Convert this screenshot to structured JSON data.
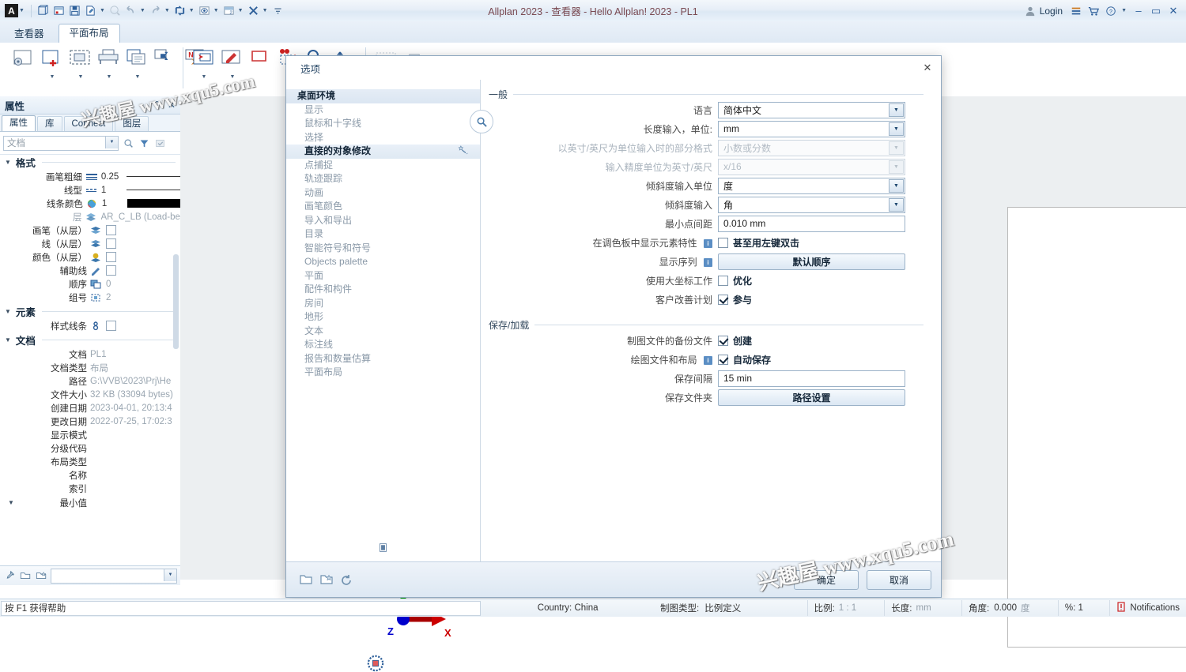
{
  "window": {
    "title": "Allplan 2023 - 查看器 - Hello Allplan! 2023 - PL1",
    "logo": "A",
    "login_label": "Login",
    "toolbar_icons": [
      "app-menu",
      "new-project",
      "project-settings",
      "save",
      "edit-file",
      "zoom",
      "undo",
      "redo",
      "refresh",
      "view",
      "layer",
      "tools",
      "overflow"
    ],
    "controls": {
      "minimize": "–",
      "maximize": "▭",
      "close": "✕"
    }
  },
  "tabs": [
    {
      "label": "查看器",
      "active": false
    },
    {
      "label": "平面布局",
      "active": true
    }
  ],
  "palette": {
    "title": "属性",
    "tabs": [
      {
        "label": "属性",
        "active": true
      },
      {
        "label": "库",
        "active": false
      },
      {
        "label": "Connect",
        "active": false
      },
      {
        "label": "图层",
        "active": false
      }
    ],
    "filter_placeholder": "文档",
    "sections": [
      {
        "name": "格式",
        "rows": [
          {
            "label": "画笔粗细",
            "icon": "pen-width-icon",
            "value": "0.25",
            "kind": "line-solid"
          },
          {
            "label": "线型",
            "icon": "line-type-icon",
            "value": "1",
            "kind": "line-thin"
          },
          {
            "label": "线条颜色",
            "icon": "color-wheel-icon",
            "value": "1",
            "kind": "swatch"
          },
          {
            "label": "层",
            "icon": "layers-icon",
            "value": "AR_C_LB (Load-bea",
            "kind": "text",
            "dim": true
          },
          {
            "label": "画笔（从层）",
            "icon": "pen-layer-icon",
            "value": "",
            "kind": "check"
          },
          {
            "label": "线（从层）",
            "icon": "line-layer-icon",
            "value": "",
            "kind": "check"
          },
          {
            "label": "颜色（从层）",
            "icon": "color-layer-icon",
            "value": "",
            "kind": "check"
          },
          {
            "label": "辅助线",
            "icon": "helper-line-icon",
            "value": "",
            "kind": "check"
          },
          {
            "label": "顺序",
            "icon": "order-icon",
            "value": "0",
            "kind": "text",
            "dim": true
          },
          {
            "label": "组号",
            "icon": "group-icon",
            "value": "2",
            "kind": "text",
            "dim": true
          }
        ]
      },
      {
        "name": "元素",
        "rows": [
          {
            "label": "样式线条",
            "icon": "style-line-icon",
            "value": "",
            "kind": "check"
          }
        ]
      },
      {
        "name": "文档",
        "rows": [
          {
            "label": "文档",
            "icon": "",
            "value": "PL1",
            "kind": "text",
            "dim": true
          },
          {
            "label": "文档类型",
            "icon": "",
            "value": "布局",
            "kind": "text",
            "dim": true
          },
          {
            "label": "路径",
            "icon": "",
            "value": "G:\\VVB\\2023\\Prj\\He",
            "kind": "text",
            "dim": true
          },
          {
            "label": "文件大小",
            "icon": "",
            "value": "32 KB (33094 bytes)",
            "kind": "text",
            "dim": true
          },
          {
            "label": "创建日期",
            "icon": "",
            "value": "2023-04-01, 20:13:4",
            "kind": "text",
            "dim": true
          },
          {
            "label": "更改日期",
            "icon": "",
            "value": "2022-07-25, 17:02:3",
            "kind": "text",
            "dim": true
          },
          {
            "label": "显示模式",
            "icon": "",
            "value": "",
            "kind": "text"
          },
          {
            "label": "分级代码",
            "icon": "",
            "value": "",
            "kind": "text"
          },
          {
            "label": "布局类型",
            "icon": "",
            "value": "",
            "kind": "text"
          },
          {
            "label": "名称",
            "icon": "",
            "value": "",
            "kind": "text"
          },
          {
            "label": "索引",
            "icon": "",
            "value": "",
            "kind": "text"
          },
          {
            "label": "最小值",
            "icon": "",
            "value": "",
            "kind": "text"
          }
        ]
      }
    ],
    "footer_icons": [
      "eyedropper-icon",
      "open-folder-icon",
      "favorite-folder-icon"
    ],
    "footer_combo_value": ""
  },
  "dialog": {
    "title": "选项",
    "close_icon": "close-icon",
    "search_icon": "search-icon",
    "nav": [
      {
        "label": "桌面环境",
        "style": "top-selected"
      },
      {
        "label": "显示",
        "style": "normal"
      },
      {
        "label": "鼠标和十字线",
        "style": "normal"
      },
      {
        "label": "选择",
        "style": "normal"
      },
      {
        "label": "直接的对象修改",
        "style": "highlight"
      },
      {
        "label": "点捕捉",
        "style": "normal"
      },
      {
        "label": "轨迹跟踪",
        "style": "normal"
      },
      {
        "label": "动画",
        "style": "normal"
      },
      {
        "label": "画笔颜色",
        "style": "normal"
      },
      {
        "label": "导入和导出",
        "style": "normal"
      },
      {
        "label": "目录",
        "style": "normal"
      },
      {
        "label": "智能符号和符号",
        "style": "normal"
      },
      {
        "label": "Objects palette",
        "style": "normal"
      },
      {
        "label": "平面",
        "style": "normal"
      },
      {
        "label": "配件和构件",
        "style": "normal"
      },
      {
        "label": "房间",
        "style": "normal"
      },
      {
        "label": "地形",
        "style": "normal"
      },
      {
        "label": "文本",
        "style": "normal"
      },
      {
        "label": "标注线",
        "style": "normal"
      },
      {
        "label": "报告和数量估算",
        "style": "normal"
      },
      {
        "label": "平面布局",
        "style": "normal"
      }
    ],
    "groups": [
      {
        "title": "一般",
        "rows": [
          {
            "label": "语言",
            "control": "combo",
            "value": "简体中文",
            "disabled": false
          },
          {
            "label": "长度输入，单位:",
            "control": "combo",
            "value": "mm",
            "disabled": false
          },
          {
            "label": "以英寸/英尺为单位输入时的部分格式",
            "control": "combo",
            "value": "小数或分数",
            "disabled": true
          },
          {
            "label": "输入精度单位为英寸/英尺",
            "control": "combo",
            "value": "x/16",
            "disabled": true
          },
          {
            "label": "倾斜度输入单位",
            "control": "combo",
            "value": "度",
            "disabled": false
          },
          {
            "label": "倾斜度输入",
            "control": "combo",
            "value": "角",
            "disabled": false
          },
          {
            "label": "最小点间距",
            "control": "textbox",
            "value": "0.010 mm",
            "disabled": false
          },
          {
            "label": "在调色板中显示元素特性",
            "control": "checkbox",
            "value": "甚至用左键双击",
            "checked": false,
            "info": true
          },
          {
            "label": "显示序列",
            "control": "button",
            "value": "默认顺序",
            "info": true
          },
          {
            "label": "使用大坐标工作",
            "control": "checkbox",
            "value": "优化",
            "checked": false
          },
          {
            "label": "客户改善计划",
            "control": "checkbox",
            "value": "参与",
            "checked": true
          }
        ]
      },
      {
        "title": "保存/加载",
        "rows": [
          {
            "label": "制图文件的备份文件",
            "control": "checkbox",
            "value": "创建",
            "checked": true
          },
          {
            "label": "绘图文件和布局",
            "control": "checkbox",
            "value": "自动保存",
            "checked": true,
            "info": true
          },
          {
            "label": "保存间隔",
            "control": "textbox",
            "value": "15 min"
          },
          {
            "label": "保存文件夹",
            "control": "button",
            "value": "路径设置"
          }
        ]
      }
    ],
    "footer_icons": [
      "open-favorite-icon",
      "save-favorite-icon",
      "reset-icon"
    ],
    "buttons": [
      {
        "label": "确定",
        "name": "ok-button"
      },
      {
        "label": "取消",
        "name": "cancel-button"
      }
    ]
  },
  "statusbar": {
    "message": "按 F1 获得帮助",
    "country_label": "Country: China",
    "drawing_type_label": "制图类型:",
    "drawing_type_value": "比例定义",
    "scale_label": "比例:",
    "scale_value": "1 : 1",
    "length_label": "长度:",
    "length_value": "mm",
    "angle_label": "角度:",
    "angle_value": "0.000",
    "angle_unit": "度",
    "percent_label": "%: 1",
    "notifications": "Notifications"
  },
  "watermark": {
    "text": "兴趣屋 www.xqu5.com"
  },
  "colors": {
    "accent": "#2d5f9a",
    "title_text": "#7a4a52",
    "dialog_border": "#8ea7bf",
    "axis_x": "#cc0000",
    "axis_y": "#00aa00",
    "axis_z": "#0000cc"
  }
}
